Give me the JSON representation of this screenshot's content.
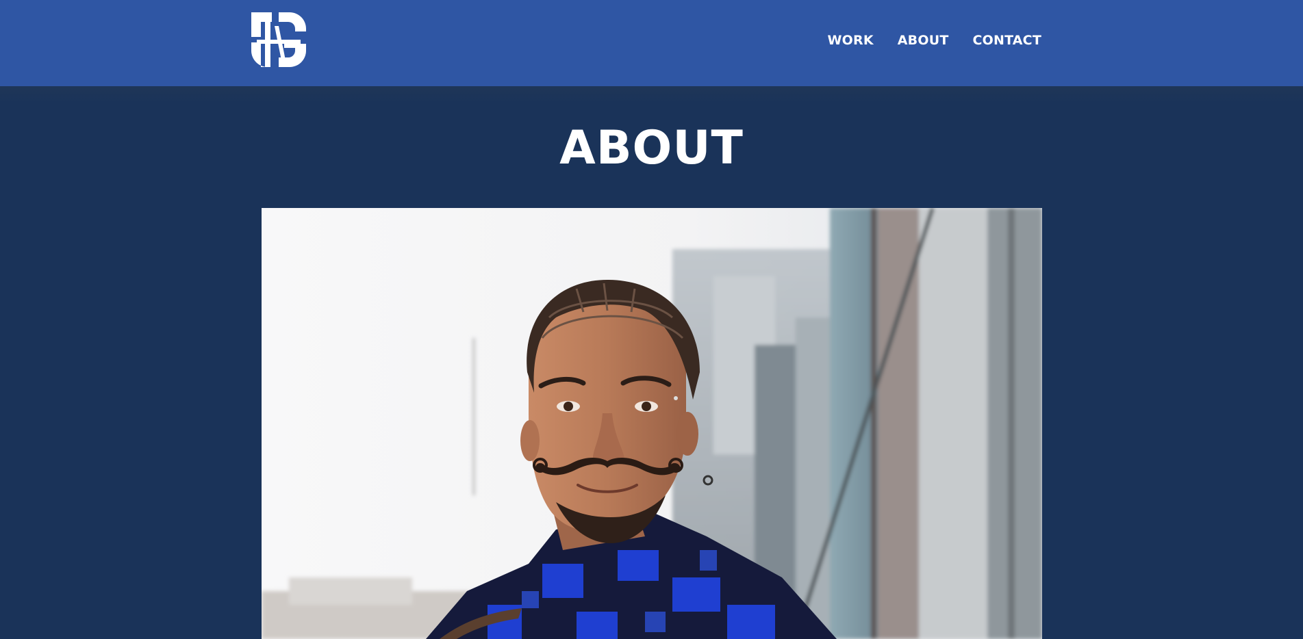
{
  "header": {
    "logo_alt": "HS logo",
    "nav": [
      {
        "label": "WORK"
      },
      {
        "label": "ABOUT"
      },
      {
        "label": "CONTACT"
      }
    ]
  },
  "main": {
    "title": "ABOUT",
    "photo": {
      "alt": "Portrait of a smiling man with braided hair and a curled mustache, wearing a blue plaid fleece jacket, standing in front of blurred city skyscrapers",
      "colors": {
        "background": "#1a3359",
        "header": "#2f56a4",
        "sky": "#f6f6f7",
        "skin": "#b5795a",
        "jacket_blue": "#1f3fd1",
        "jacket_dark": "#151a3b"
      }
    }
  }
}
